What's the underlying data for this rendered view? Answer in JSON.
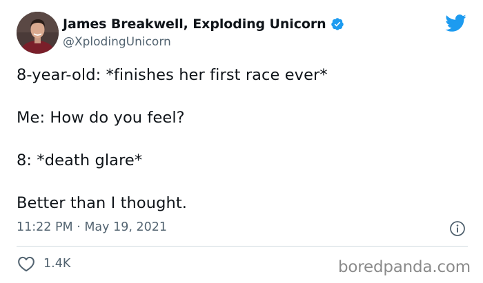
{
  "author": {
    "display_name": "James Breakwell, Exploding Unicorn",
    "handle": "@XplodingUnicorn",
    "verified": true,
    "avatar_icon": "avatar-photo"
  },
  "tweet": {
    "lines": [
      "8-year-old: *finishes her first race ever*",
      "Me: How do you feel?",
      "8: *death glare*",
      "Better than I thought."
    ],
    "timestamp": "11:22 PM · May 19, 2021"
  },
  "actions": {
    "likes": "1.4K",
    "like_icon": "heart-icon",
    "info_icon": "info-icon"
  },
  "brand": {
    "logo_icon": "twitter-bird-icon",
    "logo_color": "#1d9bf0",
    "verified_color": "#1d9bf0"
  },
  "watermark": "boredpanda.com"
}
